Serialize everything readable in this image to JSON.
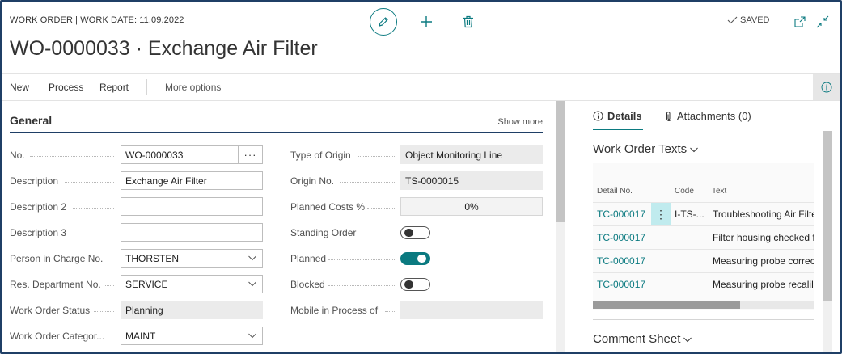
{
  "header": {
    "caption": "WORK ORDER | WORK DATE: 11.09.2022",
    "title": "WO-0000033 · Exchange Air Filter",
    "saved_label": "SAVED"
  },
  "actions": {
    "new": "New",
    "process": "Process",
    "report": "Report",
    "more_options": "More options"
  },
  "general": {
    "title": "General",
    "show_more": "Show more",
    "left_fields": [
      {
        "label": "No.",
        "value": "WO-0000033"
      },
      {
        "label": "Description",
        "value": "Exchange Air Filter"
      },
      {
        "label": "Description 2",
        "value": ""
      },
      {
        "label": "Description 3",
        "value": ""
      },
      {
        "label": "Person in Charge No.",
        "value": "THORSTEN"
      },
      {
        "label": "Res. Department No.",
        "value": "SERVICE"
      },
      {
        "label": "Work Order Status",
        "value": "Planning"
      },
      {
        "label": "Work Order Categor...",
        "value": "MAINT"
      }
    ],
    "right_fields": [
      {
        "label": "Type of Origin",
        "value": "Object Monitoring Line"
      },
      {
        "label": "Origin No.",
        "value": "TS-0000015"
      },
      {
        "label": "Planned Costs %",
        "value": "0%"
      },
      {
        "label": "Standing Order",
        "value": "off"
      },
      {
        "label": "Planned",
        "value": "on"
      },
      {
        "label": "Blocked",
        "value": "off"
      },
      {
        "label": "Mobile in Process of",
        "value": ""
      }
    ]
  },
  "factbox": {
    "tabs": {
      "details": "Details",
      "attachments": "Attachments (0)"
    },
    "work_order_texts": {
      "title": "Work Order Texts",
      "columns": [
        "Detail No.",
        "Code",
        "Text"
      ],
      "rows": [
        {
          "detail_no": "TC-000017",
          "code": "I-TS-...",
          "text": "Troubleshooting Air Filte"
        },
        {
          "detail_no": "TC-000017",
          "code": "",
          "text": "Filter housing checked f"
        },
        {
          "detail_no": "TC-000017",
          "code": "",
          "text": "Measuring probe correc"
        },
        {
          "detail_no": "TC-000017",
          "code": "",
          "text": "Measuring probe recalil"
        }
      ]
    },
    "comment_sheet": {
      "title": "Comment Sheet"
    }
  },
  "colors": {
    "accent": "#0b7a80",
    "frame": "#1f3f66",
    "readonly_bg": "#ebebeb",
    "selected_cell": "#c0ebee"
  }
}
